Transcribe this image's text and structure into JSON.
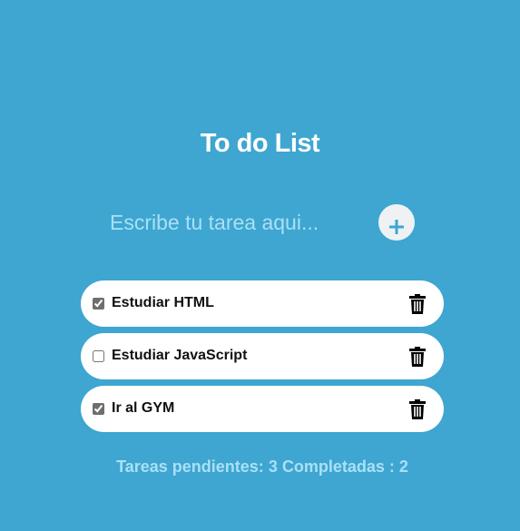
{
  "app": {
    "title": "To do List"
  },
  "entry": {
    "placeholder": "Escribe tu tarea aqui...",
    "value": "",
    "add_icon": "plus-icon"
  },
  "tasks": [
    {
      "text": "Estudiar HTML",
      "checked": true,
      "delete_icon": "trash-icon"
    },
    {
      "text": "Estudiar JavaScript",
      "checked": false,
      "delete_icon": "trash-icon"
    },
    {
      "text": "Ir al GYM",
      "checked": true,
      "delete_icon": "trash-icon"
    }
  ],
  "counters": {
    "pending_label": "Tareas pendientes:",
    "pending_count": "3",
    "completed_label": "Completadas :",
    "completed_count": "2"
  },
  "colors": {
    "background": "#3ea6d0",
    "accent_text": "#a9e0f7",
    "plus_icon": "#3ea6d0",
    "card": "#ffffff"
  }
}
